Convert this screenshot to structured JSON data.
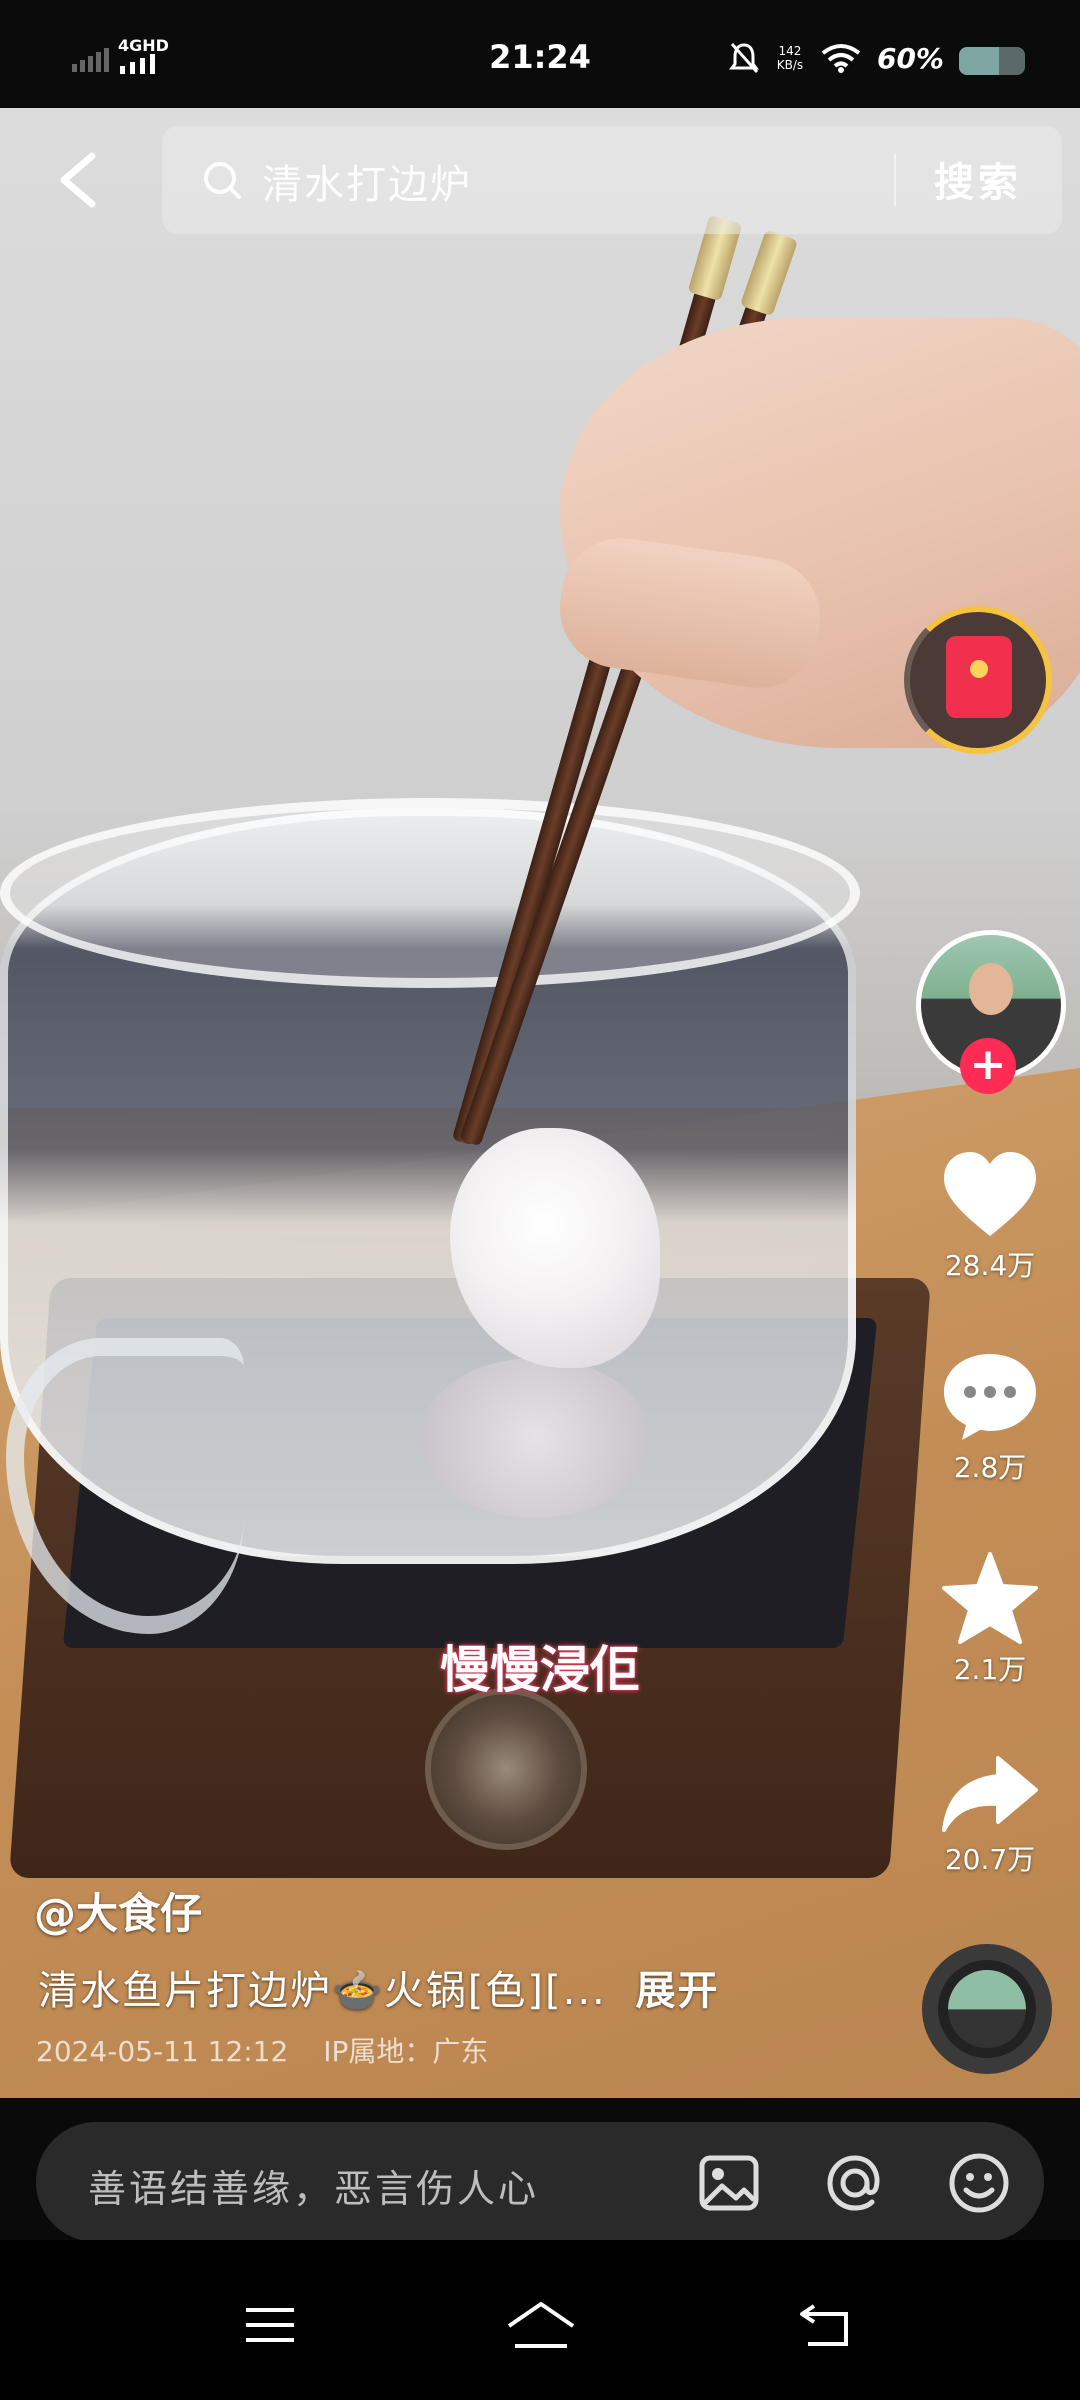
{
  "status_bar": {
    "network": "4GHD",
    "time": "21:24",
    "speed_value": "142",
    "speed_unit": "KB/s",
    "battery_text": "60%",
    "battery_level": 0.6
  },
  "search": {
    "query": "清水打边炉",
    "button_label": "搜索"
  },
  "video": {
    "subtitle": "慢慢浸佢",
    "author": "@大食仔",
    "description": "清水鱼片打边炉🍲火锅[色][...",
    "expand_label": "展开",
    "date": "2024-05-11 12:12",
    "ip_location": "IP属地：广东"
  },
  "actions": {
    "likes": "28.4万",
    "comments": "2.8万",
    "favorites": "2.1万",
    "shares": "20.7万"
  },
  "comment_bar": {
    "placeholder": "善语结善缘，恶言伤人心"
  },
  "icons": {
    "back": "chevron-left-icon",
    "search": "search-icon",
    "like": "heart-icon",
    "comment": "chat-bubble-icon",
    "favorite": "star-icon",
    "share": "share-arrow-icon",
    "image": "image-icon",
    "mention": "at-sign-icon",
    "emoji": "smiley-icon"
  },
  "colors": {
    "follow_plus": "#fe2c55",
    "red_packet": "#f0304d",
    "red_packet_ring": "#f5c242"
  }
}
